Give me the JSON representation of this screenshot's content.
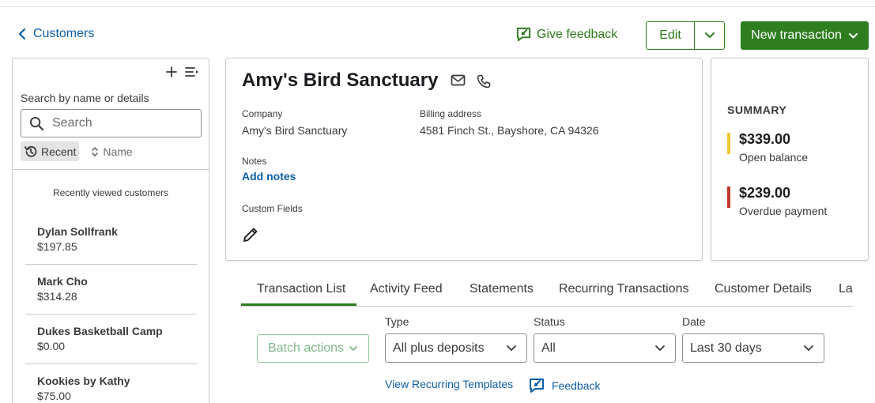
{
  "header": {
    "back_label": "Customers",
    "feedback_label": "Give feedback",
    "edit_label": "Edit",
    "new_transaction_label": "New transaction"
  },
  "sidebar": {
    "search_hint": "Search by name or details",
    "search_placeholder": "Search",
    "sort_recent": "Recent",
    "sort_name": "Name",
    "recent_title": "Recently viewed customers",
    "customers": [
      {
        "name": "Dylan Sollfrank",
        "amount": "$197.85"
      },
      {
        "name": "Mark Cho",
        "amount": "$314.28"
      },
      {
        "name": "Dukes Basketball Camp",
        "amount": "$0.00"
      },
      {
        "name": "Kookies by Kathy",
        "amount": "$75.00"
      }
    ]
  },
  "customer": {
    "name": "Amy's Bird Sanctuary",
    "company_label": "Company",
    "company_value": "Amy's Bird Sanctuary",
    "billing_label": "Billing address",
    "billing_value": "4581 Finch St., Bayshore, CA 94326",
    "notes_label": "Notes",
    "add_notes": "Add notes",
    "custom_fields_label": "Custom Fields"
  },
  "summary": {
    "title": "SUMMARY",
    "open_balance_amount": "$339.00",
    "open_balance_label": "Open balance",
    "overdue_amount": "$239.00",
    "overdue_label": "Overdue payment",
    "open_color": "#f2c832",
    "overdue_color": "#c0392b"
  },
  "tabs": [
    {
      "label": "Transaction List"
    },
    {
      "label": "Activity Feed"
    },
    {
      "label": "Statements"
    },
    {
      "label": "Recurring Transactions"
    },
    {
      "label": "Customer Details"
    },
    {
      "label": "Late Fees"
    }
  ],
  "filters": {
    "batch_label": "Batch actions",
    "type_label": "Type",
    "type_value": "All plus deposits",
    "status_label": "Status",
    "status_value": "All",
    "date_label": "Date",
    "date_value": "Last 30 days"
  },
  "links": {
    "view_recurring": "View Recurring Templates",
    "feedback": "Feedback"
  },
  "colors": {
    "brand_green": "#2e7d1e",
    "link_blue": "#0d5ea8"
  }
}
